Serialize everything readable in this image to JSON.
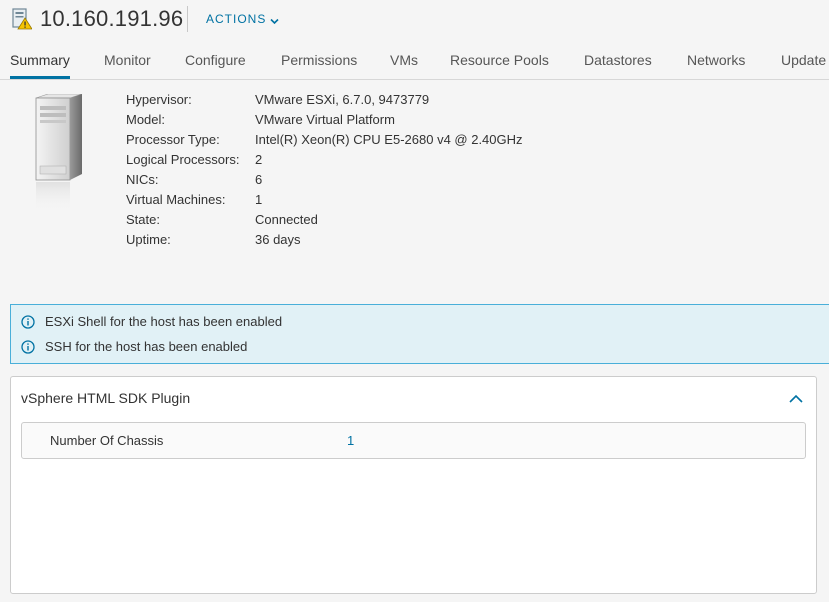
{
  "header": {
    "host_name": "10.160.191.96",
    "host_icon": "host-warning-icon",
    "actions_label": "ACTIONS"
  },
  "tabs": [
    {
      "label": "Summary",
      "active": true
    },
    {
      "label": "Monitor"
    },
    {
      "label": "Configure"
    },
    {
      "label": "Permissions"
    },
    {
      "label": "VMs"
    },
    {
      "label": "Resource Pools"
    },
    {
      "label": "Datastores"
    },
    {
      "label": "Networks"
    },
    {
      "label": "Update"
    }
  ],
  "summary": {
    "icon": "server-icon",
    "properties": [
      {
        "label": "Hypervisor:",
        "value": "VMware ESXi, 6.7.0, 9473779"
      },
      {
        "label": "Model:",
        "value": "VMware Virtual Platform"
      },
      {
        "label": "Processor Type:",
        "value": "Intel(R) Xeon(R) CPU E5-2680 v4 @ 2.40GHz"
      },
      {
        "label": "Logical Processors:",
        "value": "2"
      },
      {
        "label": "NICs:",
        "value": "6"
      },
      {
        "label": "Virtual Machines:",
        "value": "1"
      },
      {
        "label": "State:",
        "value": "Connected"
      },
      {
        "label": "Uptime:",
        "value": "36 days"
      }
    ]
  },
  "alerts": [
    {
      "icon": "info-icon",
      "text": "ESXi Shell for the host has been enabled"
    },
    {
      "icon": "info-icon",
      "text": "SSH for the host has been enabled"
    }
  ],
  "plugin_card": {
    "title": "vSphere HTML SDK Plugin",
    "collapse_icon": "chevron-up-icon",
    "rows": [
      {
        "label": "Number Of Chassis",
        "value": "1"
      }
    ]
  },
  "colors": {
    "accent": "#0072a3",
    "alert_bg": "#e1f1f6",
    "alert_border": "#49afd9",
    "warning": "#f5c400"
  }
}
